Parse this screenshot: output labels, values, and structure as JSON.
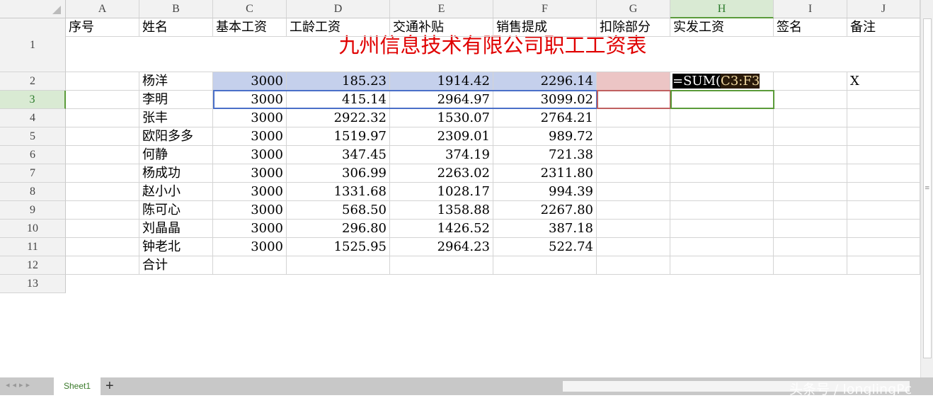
{
  "columns": [
    "A",
    "B",
    "C",
    "D",
    "E",
    "F",
    "G",
    "H",
    "I",
    "J"
  ],
  "rows": [
    "1",
    "2",
    "3",
    "4",
    "5",
    "6",
    "7",
    "8",
    "9",
    "10",
    "11",
    "12",
    "13"
  ],
  "title": "九州信息技术有限公司职工工资表",
  "headers": [
    "序号",
    "姓名",
    "基本工资",
    "工龄工资",
    "交通补贴",
    "销售提成",
    "扣除部分",
    "实发工资",
    "签名",
    "备注"
  ],
  "records": [
    [
      "杨洋",
      "3000",
      "185.23",
      "1914.42",
      "2296.14"
    ],
    [
      "李明",
      "3000",
      "415.14",
      "2964.97",
      "3099.02"
    ],
    [
      "张丰",
      "3000",
      "2922.32",
      "1530.07",
      "2764.21"
    ],
    [
      "欧阳多多",
      "3000",
      "1519.97",
      "2309.01",
      "989.72"
    ],
    [
      "何静",
      "3000",
      "347.45",
      "374.19",
      "721.38"
    ],
    [
      "杨成功",
      "3000",
      "306.99",
      "2263.02",
      "2311.80"
    ],
    [
      "赵小小",
      "3000",
      "1331.68",
      "1028.17",
      "994.39"
    ],
    [
      "陈可心",
      "3000",
      "568.50",
      "1358.88",
      "2267.80"
    ],
    [
      "刘晶晶",
      "3000",
      "296.80",
      "1426.52",
      "387.18"
    ],
    [
      "钟老北",
      "3000",
      "1525.95",
      "2964.23",
      "522.74"
    ]
  ],
  "total_label": "合计",
  "formula": {
    "prefix": "=SUM(",
    "ref": "C3:F3"
  },
  "j3": "X",
  "sheet_tab": "Sheet1",
  "add_sheet": "+",
  "watermark": "头条号 / longlingPc"
}
